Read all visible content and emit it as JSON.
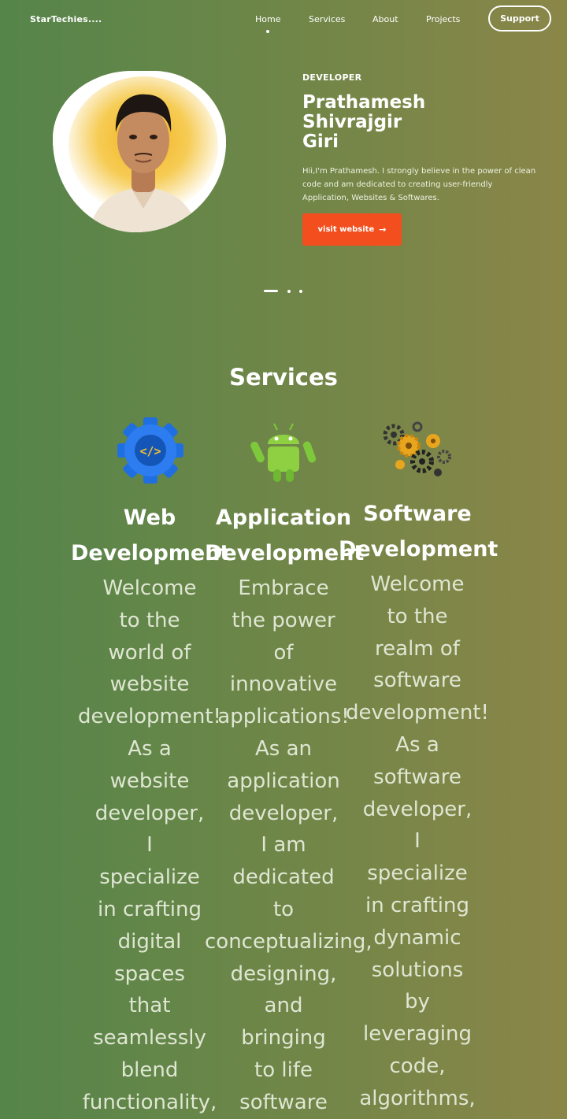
{
  "nav": {
    "brand": "StarTechies....",
    "items": [
      "Home",
      "Services",
      "About",
      "Projects"
    ],
    "support_label": "Support"
  },
  "hero": {
    "role": "DEVELOPER",
    "name_lines": [
      "Prathamesh",
      "Shivrajgir",
      "Giri"
    ],
    "bio_lines": [
      "Hii,I'm Prathamesh. I strongly believe in the power of clean",
      "code and am dedicated to creating user-friendly",
      "Application, Websites & Softwares."
    ],
    "button_label": "visit website",
    "button_icon": "arrow-right-icon"
  },
  "services": {
    "title": "Services",
    "cards": [
      {
        "icon": "web-gear-code-icon",
        "title_lines": [
          "Web",
          "Development"
        ],
        "desc_lines": [
          "Welcome",
          "to the",
          "world of",
          "website",
          "development!",
          "As a",
          "website",
          "developer,",
          "I",
          "specialize",
          "in crafting",
          "digital",
          "spaces",
          "that",
          "seamlessly",
          "blend",
          "functionality,"
        ]
      },
      {
        "icon": "android-robot-icon",
        "title_lines": [
          "Application",
          "Development"
        ],
        "desc_lines": [
          "Embrace",
          "the power",
          "of",
          "innovative",
          "applications!",
          "As an",
          "application",
          "developer,",
          "I am",
          "dedicated",
          "to",
          "conceptualizing,",
          "designing,",
          "and",
          "bringing",
          "to life",
          "software"
        ]
      },
      {
        "icon": "gears-icon",
        "title_lines": [
          "Software",
          "Development"
        ],
        "desc_lines": [
          "Welcome",
          "to the",
          "realm of",
          "software",
          "development!",
          "As a",
          "software",
          "developer,",
          "I",
          "specialize",
          "in crafting",
          "dynamic",
          "solutions",
          "by",
          "leveraging",
          "code,",
          "algorithms,"
        ]
      }
    ]
  },
  "colors": {
    "accent": "#f24e1e",
    "background_left": "#55854a",
    "background_right": "#8a8648"
  }
}
